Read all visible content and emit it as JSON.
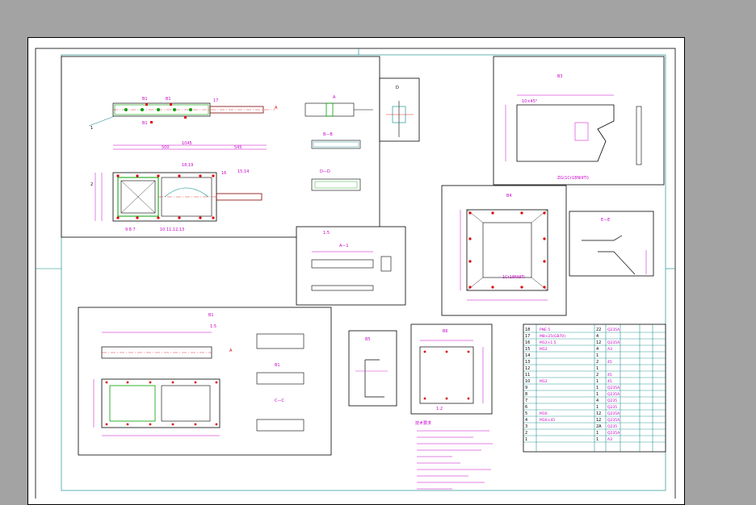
{
  "drawing": {
    "views": {
      "view_a": "A",
      "view_b": "B—B",
      "view_c": "C—C",
      "view_d": "D—D",
      "view_e": "E—E",
      "view_a2": "A",
      "section_a": "A—1",
      "scale_1_5": "1:5",
      "scale_1_2": "1:2"
    },
    "title_block": {
      "rows": [
        {
          "no": "18",
          "name": "PNE 5",
          "qty": "22",
          "mat": "Q235A"
        },
        {
          "no": "17",
          "name": "M8×25(GB70)",
          "qty": "4",
          "mat": ""
        },
        {
          "no": "16",
          "name": "M12×1.5",
          "qty": "12",
          "mat": "Q235A"
        },
        {
          "no": "15",
          "name": "M12",
          "qty": "4",
          "mat": "A3"
        },
        {
          "no": "14",
          "name": "",
          "qty": "1",
          "mat": ""
        },
        {
          "no": "13",
          "name": "",
          "qty": "2",
          "mat": "45"
        },
        {
          "no": "12",
          "name": "",
          "qty": "1",
          "mat": ""
        },
        {
          "no": "11",
          "name": "",
          "qty": "2",
          "mat": "45"
        },
        {
          "no": "10",
          "name": "M12",
          "qty": "1",
          "mat": "45"
        },
        {
          "no": "9",
          "name": "",
          "qty": "1",
          "mat": "Q235A"
        },
        {
          "no": "8",
          "name": "",
          "qty": "1",
          "mat": "Q235A"
        },
        {
          "no": "7",
          "name": "",
          "qty": "4",
          "mat": "Q235"
        },
        {
          "no": "6",
          "name": "",
          "qty": "1",
          "mat": "Q235"
        },
        {
          "no": "5",
          "name": "M16",
          "qty": "12",
          "mat": "Q235A"
        },
        {
          "no": "4",
          "name": "M16×45",
          "qty": "12",
          "mat": "Q235A"
        },
        {
          "no": "3",
          "name": "",
          "qty": "2A",
          "mat": "Q235"
        },
        {
          "no": "2",
          "name": "",
          "qty": "1",
          "mat": "Q235A"
        },
        {
          "no": "1",
          "name": "",
          "qty": "1",
          "mat": "A3"
        }
      ]
    }
  }
}
